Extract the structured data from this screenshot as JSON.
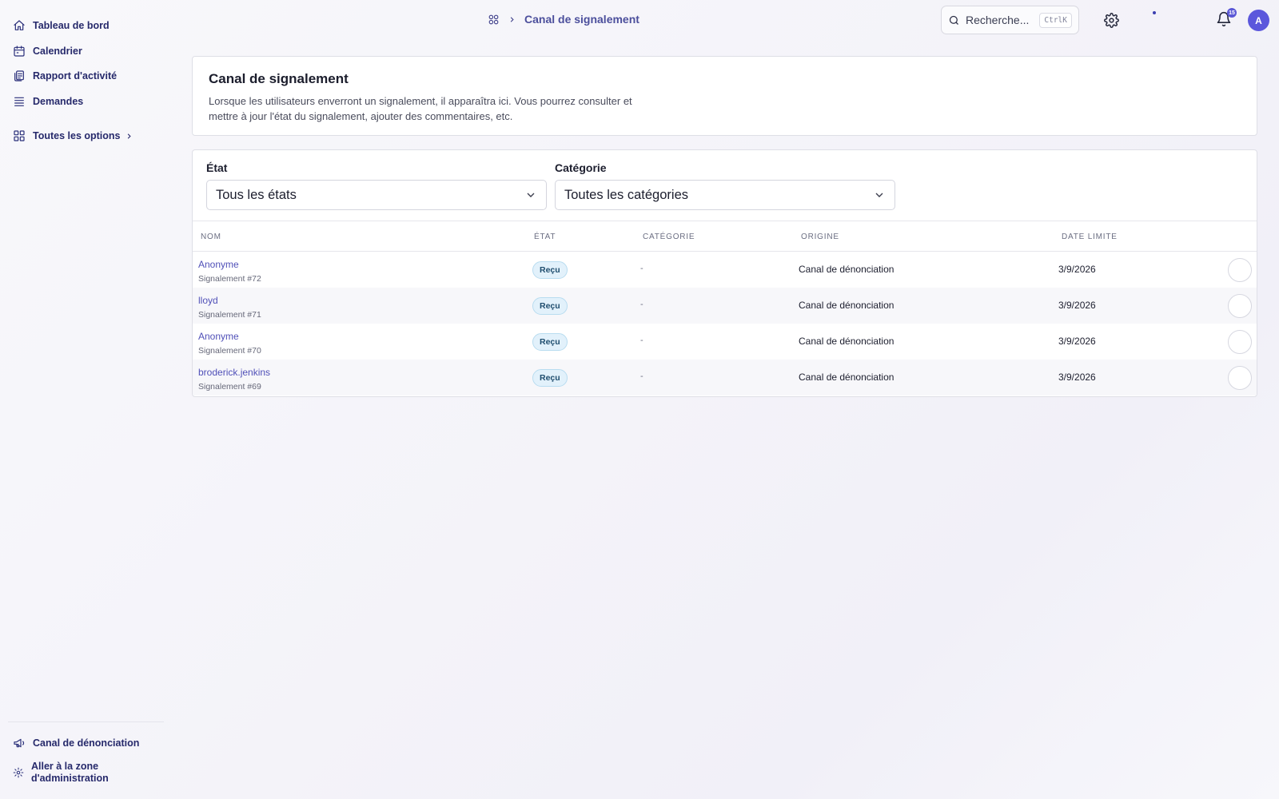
{
  "sidebar": {
    "items": [
      {
        "label": "Tableau de bord",
        "icon": "home-icon"
      },
      {
        "label": "Calendrier",
        "icon": "calendar-icon"
      },
      {
        "label": "Rapport d'activité",
        "icon": "report-icon"
      },
      {
        "label": "Demandes",
        "icon": "stack-icon"
      },
      {
        "label": "Toutes les options",
        "icon": "grid-icon"
      }
    ],
    "footer": {
      "whistle": "Canal de dénonciation",
      "admin": "Aller à la zone d'administration"
    }
  },
  "header": {
    "breadcrumb": "Canal de signalement",
    "search_placeholder": "Recherche...",
    "search_shortcut": "CtrlK",
    "notification_count": "15",
    "avatar_initial": "A"
  },
  "intro": {
    "title": "Canal de signalement",
    "description": "Lorsque les utilisateurs enverront un signalement, il apparaîtra ici. Vous pourrez consulter et mettre à jour l'état du signalement, ajouter des commentaires, etc."
  },
  "filters": {
    "state_label": "État",
    "state_value": "Tous les états",
    "category_label": "Catégorie",
    "category_value": "Toutes les catégories"
  },
  "table": {
    "headers": {
      "name": "NOM",
      "state": "ÉTAT",
      "category": "CATÉGORIE",
      "origin": "ORIGINE",
      "deadline": "DATE LIMITE"
    },
    "rows": [
      {
        "name": "Anonyme",
        "ref": "Signalement #72",
        "state": "Reçu",
        "category": "-",
        "origin": "Canal de dénonciation",
        "deadline": "3/9/2026"
      },
      {
        "name": "lloyd",
        "ref": "Signalement #71",
        "state": "Reçu",
        "category": "-",
        "origin": "Canal de dénonciation",
        "deadline": "3/9/2026"
      },
      {
        "name": "Anonyme",
        "ref": "Signalement #70",
        "state": "Reçu",
        "category": "-",
        "origin": "Canal de dénonciation",
        "deadline": "3/9/2026"
      },
      {
        "name": "broderick.jenkins",
        "ref": "Signalement #69",
        "state": "Reçu",
        "category": "-",
        "origin": "Canal de dénonciation",
        "deadline": "3/9/2026"
      }
    ]
  },
  "colors": {
    "accent": "#5b57dc",
    "nav_text": "#26296b",
    "status_bg": "#e2f1fb"
  }
}
